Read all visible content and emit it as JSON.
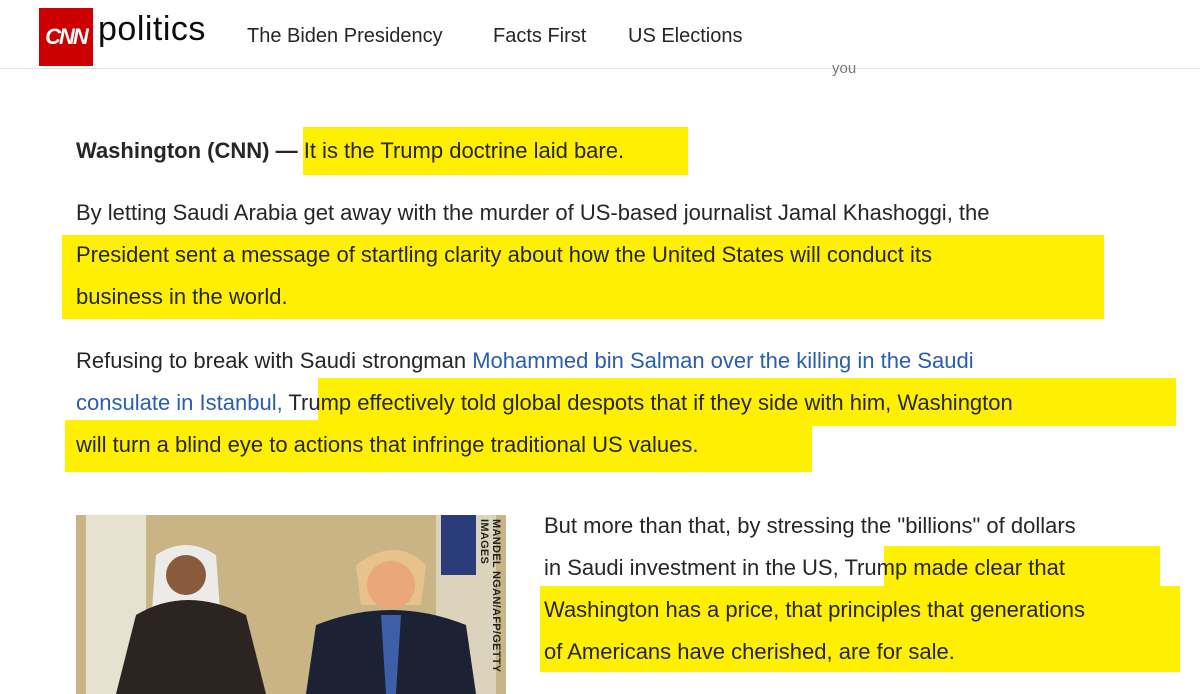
{
  "header": {
    "logo_text": "CNN",
    "section_name": "politics",
    "nav": [
      "The Biden Presidency",
      "Facts First",
      "US Elections"
    ]
  },
  "partial_text": "you",
  "article": {
    "dateline": "Washington (CNN) —",
    "p1_highlight": "It is the Trump doctrine laid bare.",
    "p2_line1": "By letting Saudi Arabia get away with the murder of US-based journalist Jamal Khashoggi, the",
    "p2_line2": "President sent a message of startling clarity about how the United States will conduct its",
    "p2_line3": "business in the world.",
    "p3_line1_plain": "Refusing to break with Saudi strongman ",
    "p3_link_line1": "Mohammed bin Salman over the killing in the Saudi",
    "p3_link_line2": "consulate in Istanbul,",
    "p3_line2_hl": "Trump effectively told global despots that if they side with him, Washington",
    "p3_line3_hl": "will turn a blind eye to actions that infringe traditional US values.",
    "p4_line1": "But more than that, by stressing the \"billions\" of dollars",
    "p4_line2_plain": "in Saudi investment in the US, ",
    "p4_line2_hl": "Trump made clear that",
    "p4_line3": "Washington has a price, that principles that generations",
    "p4_line4": "of Americans have cherished, are for sale.",
    "photo_credit": "MANDEL NGAN/AFP/GETTY IMAGES"
  },
  "colors": {
    "highlight": "#ffef00",
    "link": "#2a5db0",
    "brand_red": "#cc0000"
  }
}
